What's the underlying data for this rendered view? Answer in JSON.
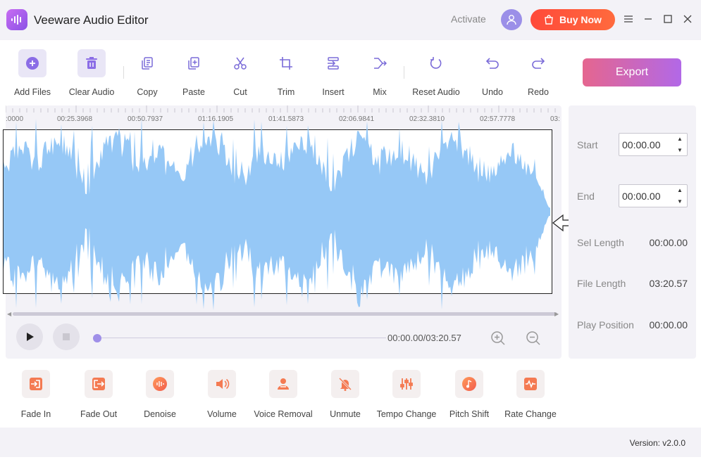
{
  "app": {
    "title": "Veeware Audio Editor",
    "activate_label": "Activate",
    "buy_label": "Buy Now",
    "logo_icon": "waveform-logo-icon"
  },
  "window_controls": [
    "menu-icon",
    "minimize-icon",
    "maximize-icon",
    "close-icon"
  ],
  "toolbar": {
    "add_files": "Add Files",
    "clear_audio": "Clear Audio",
    "copy": "Copy",
    "paste": "Paste",
    "cut": "Cut",
    "trim": "Trim",
    "insert": "Insert",
    "mix": "Mix",
    "reset_audio": "Reset Audio",
    "undo": "Undo",
    "redo": "Redo",
    "export": "Export"
  },
  "timeline": {
    "ticks": [
      ":0000",
      "00:25.3968",
      "00:50.7937",
      "01:16.1905",
      "01:41.5873",
      "02:06.9841",
      "02:32.3810",
      "02:57.7778",
      "03:"
    ]
  },
  "player": {
    "time": "00:00.00/03:20.57",
    "progress_fraction": 0
  },
  "info": {
    "start_label": "Start",
    "start_value": "00:00.00",
    "end_label": "End",
    "end_value": "00:00.00",
    "sel_length_label": "Sel Length",
    "sel_length_value": "00:00.00",
    "file_length_label": "File Length",
    "file_length_value": "03:20.57",
    "play_position_label": "Play Position",
    "play_position_value": "00:00.00"
  },
  "effects": [
    {
      "label": "Fade In",
      "icon": "fade-in-icon"
    },
    {
      "label": "Fade Out",
      "icon": "fade-out-icon"
    },
    {
      "label": "Denoise",
      "icon": "denoise-icon"
    },
    {
      "label": "Volume",
      "icon": "volume-icon"
    },
    {
      "label": "Voice Removal",
      "icon": "voice-removal-icon"
    },
    {
      "label": "Unmute",
      "icon": "unmute-icon"
    },
    {
      "label": "Tempo Change",
      "icon": "tempo-change-icon"
    },
    {
      "label": "Pitch Shift",
      "icon": "pitch-shift-icon"
    },
    {
      "label": "Rate Change",
      "icon": "rate-change-icon"
    }
  ],
  "footer": {
    "version": "Version: v2.0.0"
  },
  "colors": {
    "accent": "#9b6fe8",
    "buy": "#ff4a3a",
    "waveform": "#96c8f6",
    "icon": "#7a6bd8"
  }
}
